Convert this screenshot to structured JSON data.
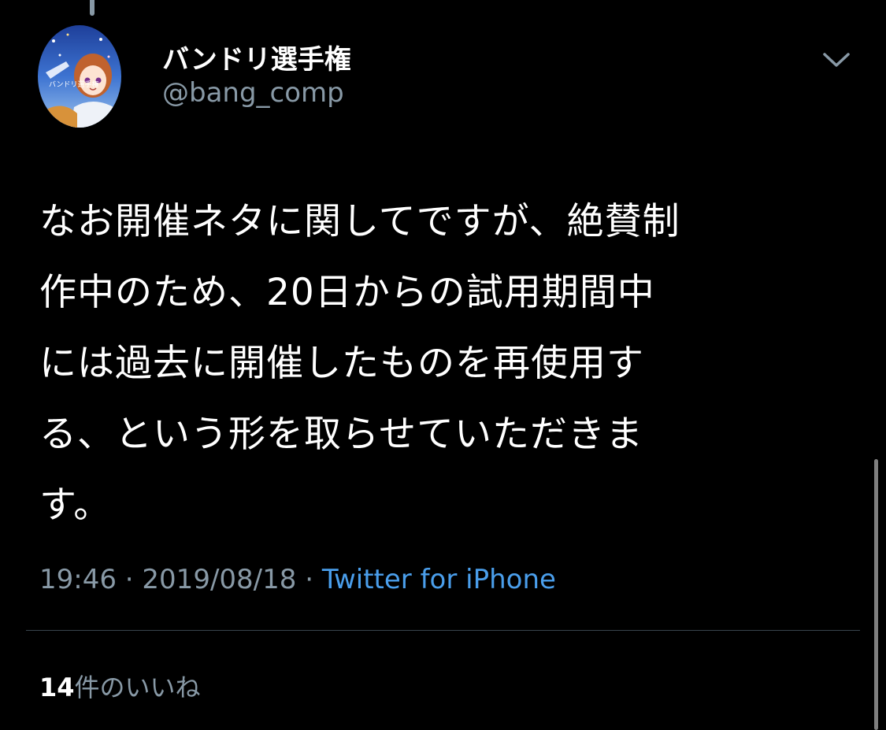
{
  "tweet": {
    "display_name": "バンドリ選手権",
    "handle": "@bang_comp",
    "avatar_icon": "profile-avatar-anime-girl",
    "more_icon": "chevron-down-icon",
    "text_lines": [
      "なお開催ネタに関してですが、絶賛制",
      "作中のため、20日からの試用期間中",
      "には過去に開催したものを再使用す",
      "る、という形を取らせていただきま",
      "す。"
    ],
    "time": "19:46",
    "separator": " · ",
    "date": "2019/08/18",
    "source": "Twitter for iPhone",
    "likes_count": "14",
    "likes_label": "件のいいね"
  },
  "colors": {
    "background": "#000000",
    "primary_text": "#ffffff",
    "secondary_text": "#8899a6",
    "link": "#4a9eeb",
    "divider": "#38444d"
  }
}
